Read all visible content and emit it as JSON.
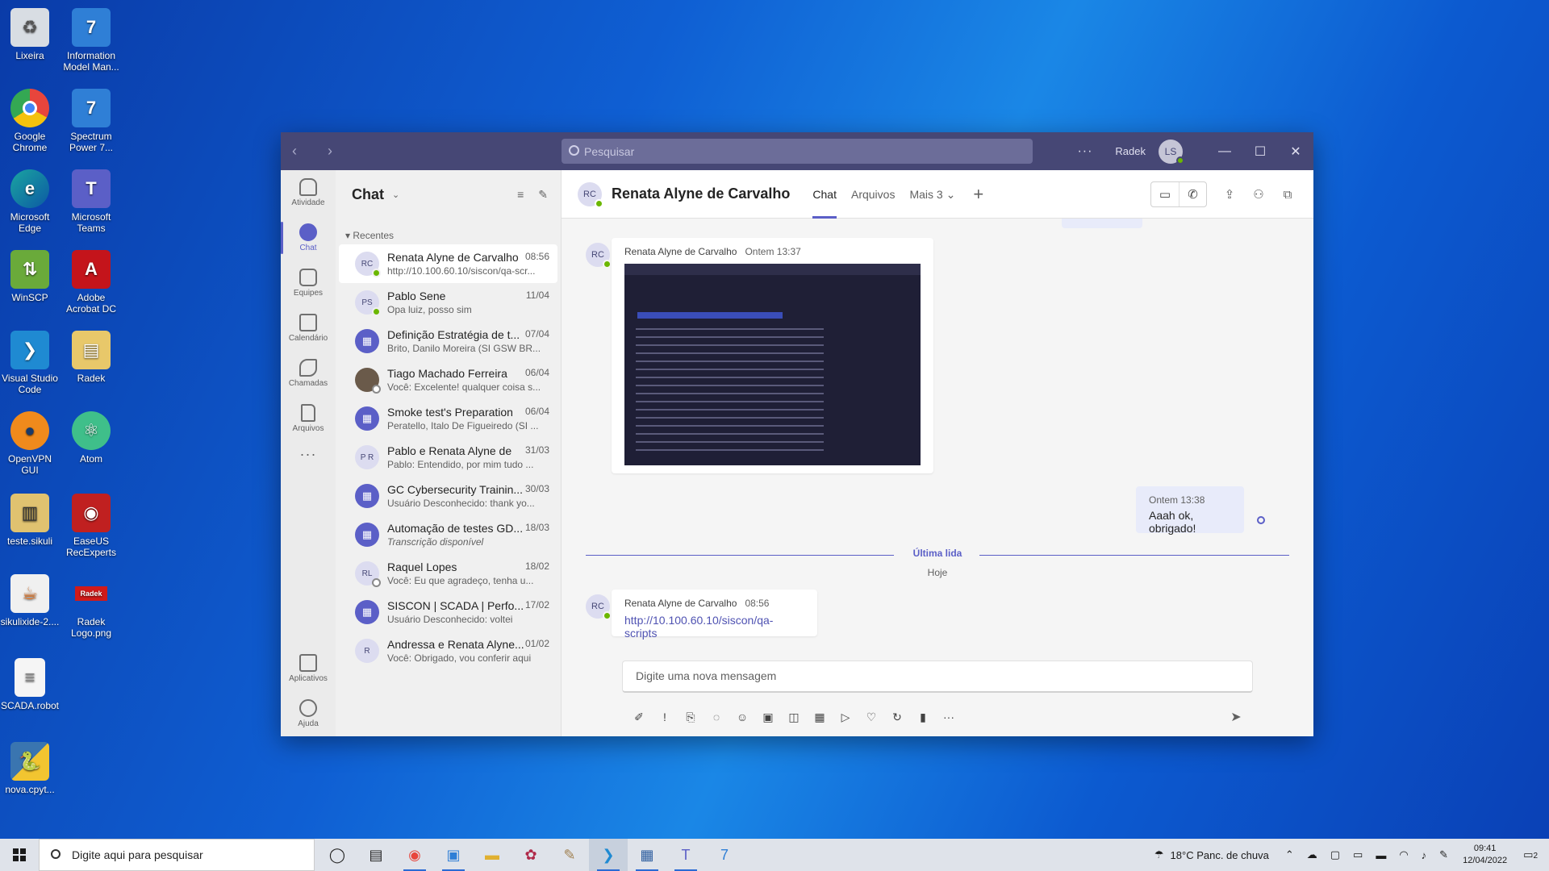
{
  "desktop": {
    "icons": [
      {
        "label": "Lixeira",
        "icon": "recycle-bin-icon",
        "color": "#d8dde3"
      },
      {
        "label": "Information Model Man...",
        "icon": "information-model-icon",
        "color": "#2f7fd6"
      },
      {
        "label": "Google Chrome",
        "icon": "chrome-icon",
        "color": "#e8453c"
      },
      {
        "label": "Spectrum Power 7...",
        "icon": "spectrum-power-icon",
        "color": "#2f7fd6"
      },
      {
        "label": "Microsoft Edge",
        "icon": "edge-icon",
        "color": "#1aa5a0"
      },
      {
        "label": "Microsoft Teams",
        "icon": "teams-icon",
        "color": "#5b5fc7"
      },
      {
        "label": "WinSCP",
        "icon": "winscp-icon",
        "color": "#6aaa3a"
      },
      {
        "label": "Adobe Acrobat DC",
        "icon": "acrobat-icon",
        "color": "#c4141b"
      },
      {
        "label": "Visual Studio Code",
        "icon": "vscode-icon",
        "color": "#1f8ad2"
      },
      {
        "label": "Radek",
        "icon": "folder-icon",
        "color": "#e8c86a"
      },
      {
        "label": "OpenVPN GUI",
        "icon": "openvpn-icon",
        "color": "#f08a1c"
      },
      {
        "label": "Atom",
        "icon": "atom-icon",
        "color": "#3fbf8a"
      },
      {
        "label": "teste.sikuli",
        "icon": "sikuli-file-icon",
        "color": "#e0c270"
      },
      {
        "label": "EaseUS RecExperts",
        "icon": "easeus-icon",
        "color": "#c02020"
      },
      {
        "label": "sikulixide-2....",
        "icon": "java-icon",
        "color": "#f0f0f0"
      },
      {
        "label": "Radek Logo.png",
        "icon": "image-file-icon",
        "color": "#d01a1a"
      },
      {
        "label": "SCADA.robot",
        "icon": "text-file-icon",
        "color": "#f5f5f5"
      },
      {
        "label": "nova.cpyt...",
        "icon": "python-icon",
        "color": "#3a75b0"
      }
    ]
  },
  "window": {
    "search_placeholder": "Pesquisar",
    "more": "···",
    "user_name": "Radek",
    "user_initials": "LS"
  },
  "rail": {
    "items": [
      {
        "label": "Atividade",
        "icon": "bell-icon"
      },
      {
        "label": "Chat",
        "icon": "chat-icon"
      },
      {
        "label": "Equipes",
        "icon": "teams-group-icon"
      },
      {
        "label": "Calendário",
        "icon": "calendar-icon"
      },
      {
        "label": "Chamadas",
        "icon": "phone-icon"
      },
      {
        "label": "Arquivos",
        "icon": "file-icon"
      }
    ],
    "more": "···",
    "apps": "Aplicativos",
    "help": "Ajuda"
  },
  "chatlist": {
    "title": "Chat",
    "section": "Recentes",
    "items": [
      {
        "initials": "RC",
        "name": "Renata Alyne de Carvalho",
        "preview": "http://10.100.60.10/siscon/qa-scr...",
        "date": "08:56",
        "type": "person",
        "status": "online"
      },
      {
        "initials": "PS",
        "name": "Pablo Sene",
        "preview": "Opa luiz, posso sim",
        "date": "11/04",
        "type": "person",
        "status": "online"
      },
      {
        "initials": "",
        "name": "Definição Estratégia de t...",
        "preview": "Brito, Danilo Moreira (SI GSW BR...",
        "date": "07/04",
        "type": "meeting",
        "status": ""
      },
      {
        "initials": "",
        "name": "Tiago Machado Ferreira",
        "preview": "Você: Excelente! qualquer coisa s...",
        "date": "06/04",
        "type": "photo",
        "status": "away"
      },
      {
        "initials": "",
        "name": "Smoke test's Preparation",
        "preview": "Peratello, Italo De Figueiredo (SI ...",
        "date": "06/04",
        "type": "meeting",
        "status": ""
      },
      {
        "initials": "P R",
        "name": "Pablo e Renata Alyne de",
        "preview": "Pablo: Entendido, por mim tudo ...",
        "date": "31/03",
        "type": "group",
        "status": ""
      },
      {
        "initials": "",
        "name": "GC Cybersecurity Trainin...",
        "preview": "Usuário Desconhecido: thank yo...",
        "date": "30/03",
        "type": "meeting",
        "status": ""
      },
      {
        "initials": "",
        "name": "Automação de testes GD...",
        "preview": "Transcrição disponível",
        "date": "18/03",
        "type": "meeting",
        "status": "",
        "italic": true
      },
      {
        "initials": "RL",
        "name": "Raquel Lopes",
        "preview": "Você: Eu que agradeço, tenha u...",
        "date": "18/02",
        "type": "person",
        "status": "away"
      },
      {
        "initials": "",
        "name": "SISCON | SCADA | Perfo...",
        "preview": "Usuário Desconhecido: voltei",
        "date": "17/02",
        "type": "meeting",
        "status": ""
      },
      {
        "initials": "R",
        "name": "Andressa e Renata Alyne...",
        "preview": "Você: Obrigado, vou conferir aqui",
        "date": "01/02",
        "type": "group-photo",
        "status": ""
      }
    ]
  },
  "conversation": {
    "initials": "RC",
    "name": "Renata Alyne de Carvalho",
    "tabs": [
      "Chat",
      "Arquivos",
      "Mais 3"
    ],
    "messages": [
      {
        "author": "Renata Alyne de Carvalho",
        "time": "Ontem 13:37",
        "kind": "image"
      },
      {
        "author": "",
        "time": "Ontem 13:38",
        "text": "Aaah ok, obrigado!",
        "kind": "mine"
      },
      {
        "author": "Renata Alyne de Carvalho",
        "time": "08:56",
        "text": "http://10.100.60.10/siscon/qa-scripts",
        "kind": "link"
      }
    ],
    "last_read": "Última lida",
    "today": "Hoje",
    "composer_placeholder": "Digite uma nova mensagem"
  },
  "taskbar": {
    "search_placeholder": "Digite aqui para pesquisar",
    "weather": "18°C  Panc. de chuva",
    "time": "09:41",
    "date": "12/04/2022",
    "notifications": "2"
  },
  "colors": {
    "teams_purple": "#464775",
    "accent": "#5b5fc7",
    "online": "#6bb700"
  }
}
